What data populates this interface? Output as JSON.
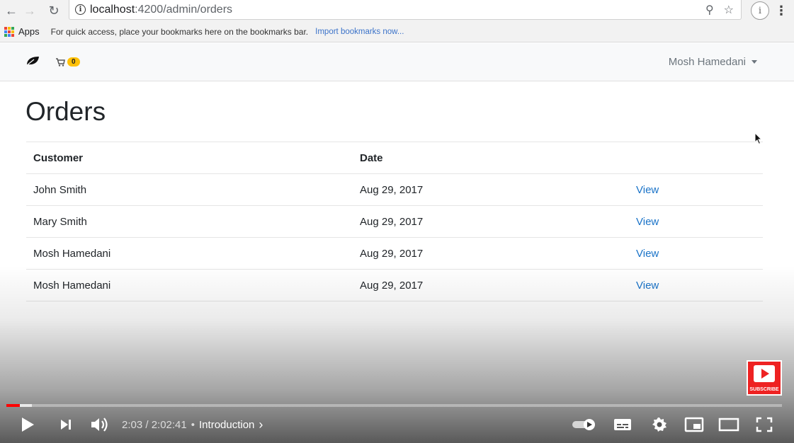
{
  "browser": {
    "url_host": "localhost",
    "url_path": ":4200/admin/orders",
    "bookmarks": {
      "apps_label": "Apps",
      "hint": "For quick access, place your bookmarks here on the bookmarks bar.",
      "import_link": "Import bookmarks now..."
    },
    "profile_letter": "i"
  },
  "navbar": {
    "cart_count": "0",
    "user_name": "Mosh Hamedani"
  },
  "page": {
    "title": "Orders",
    "columns": [
      "Customer",
      "Date",
      ""
    ],
    "rows": [
      {
        "customer": "John Smith",
        "date": "Aug 29, 2017",
        "action": "View"
      },
      {
        "customer": "Mary Smith",
        "date": "Aug 29, 2017",
        "action": "View"
      },
      {
        "customer": "Mosh Hamedani",
        "date": "Aug 29, 2017",
        "action": "View"
      },
      {
        "customer": "Mosh Hamedani",
        "date": "Aug 29, 2017",
        "action": "View"
      }
    ]
  },
  "player": {
    "time": "2:03 / 2:02:41",
    "separator": "•",
    "chapter": "Introduction",
    "subscribe_label": "SUBSCRIBE",
    "played_fraction": 0.017,
    "buffered_fraction": 0.033
  },
  "colors": {
    "link": "#1a73c8",
    "badge": "#ffc107",
    "progress": "#ff0000"
  }
}
